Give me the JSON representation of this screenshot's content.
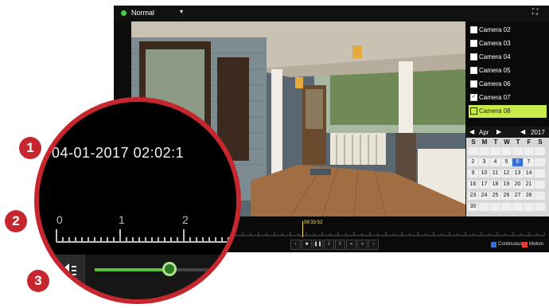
{
  "header": {
    "mode_label": "Normal",
    "mode_caret": "▾",
    "fullscreen_icon": "fullscreen-icon"
  },
  "cameras": [
    {
      "label": "Camera 02",
      "checked": false
    },
    {
      "label": "Camera 03",
      "checked": false
    },
    {
      "label": "Camera 04",
      "checked": false
    },
    {
      "label": "Camera 05",
      "checked": false
    },
    {
      "label": "Camera 06",
      "checked": false
    },
    {
      "label": "Camera 07",
      "checked": true
    },
    {
      "label": "Camera 08",
      "checked": false,
      "selected": true
    }
  ],
  "calendar": {
    "month": "Apr",
    "year": "2017",
    "weekdays": [
      "S",
      "M",
      "T",
      "W",
      "T",
      "F",
      "S"
    ],
    "rows": [
      [
        "",
        "",
        "",
        "",
        "",
        "",
        ""
      ],
      [
        "2",
        "3",
        "4",
        "5",
        "6",
        "7",
        ""
      ],
      [
        "9",
        "10",
        "11",
        "12",
        "13",
        "14",
        ""
      ],
      [
        "16",
        "17",
        "18",
        "19",
        "20",
        "21",
        ""
      ],
      [
        "23",
        "24",
        "25",
        "26",
        "27",
        "28",
        ""
      ],
      [
        "30",
        "",
        "",
        "",
        "",
        "",
        ""
      ]
    ],
    "today": "6"
  },
  "timeline": {
    "cursor_time": "09:33:52",
    "legend": [
      {
        "label": "Continuous",
        "color": "#3a6fd6"
      },
      {
        "label": "Motion",
        "color": "#e23b3b"
      }
    ]
  },
  "zoom": {
    "datetime": "04-01-2017 02:02:1",
    "scale_labels": [
      "0",
      "1",
      "2"
    ],
    "volume_level": 0.55
  },
  "callouts": [
    "1",
    "2",
    "3"
  ],
  "colors": {
    "accent_red": "#c6262e",
    "selected_green": "#c8ea4a",
    "slider_green": "#5cc13a"
  }
}
